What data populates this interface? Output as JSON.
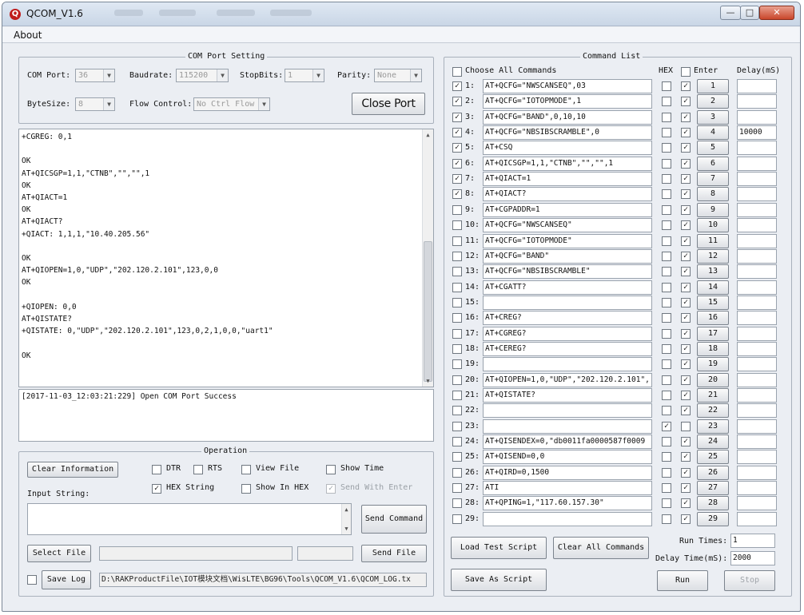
{
  "window": {
    "title": "QCOM_V1.6",
    "app_icon_glyph": "Q",
    "controls": {
      "minimize": "—",
      "maximize": "□",
      "close": "✕"
    }
  },
  "menu": {
    "about": "About"
  },
  "com_port": {
    "group_label": "COM Port Setting",
    "com_port_label": "COM Port:",
    "com_port_value": "36",
    "baudrate_label": "Baudrate:",
    "baudrate_value": "115200",
    "stopbits_label": "StopBits:",
    "stopbits_value": "1",
    "parity_label": "Parity:",
    "parity_value": "None",
    "bytesize_label": "ByteSize:",
    "bytesize_value": "8",
    "flow_label": "Flow Control:",
    "flow_value": "No Ctrl Flow",
    "close_port_label": "Close Port",
    "dropdown_icon": "▼"
  },
  "receive_log": [
    "+CGREG: 0,1",
    "",
    "OK",
    "AT+QICSGP=1,1,\"CTNB\",\"\",\"\",1",
    "OK",
    "AT+QIACT=1",
    "OK",
    "AT+QIACT?",
    "+QIACT: 1,1,1,\"10.40.205.56\"",
    "",
    "OK",
    "AT+QIOPEN=1,0,\"UDP\",\"202.120.2.101\",123,0,0",
    "OK",
    "",
    "+QIOPEN: 0,0",
    "AT+QISTATE?",
    "+QISTATE: 0,\"UDP\",\"202.120.2.101\",123,0,2,1,0,0,\"uart1\"",
    "",
    "OK"
  ],
  "status_log": "[2017-11-03_12:03:21:229] Open COM Port Success",
  "operation": {
    "group_label": "Operation",
    "clear_info_label": "Clear Information",
    "input_string_label": "Input String:",
    "dtr_label": "DTR",
    "dtr_checked": false,
    "rts_label": "RTS",
    "rts_checked": false,
    "view_file_label": "View File",
    "view_file_checked": false,
    "show_time_label": "Show Time",
    "show_time_checked": false,
    "hex_string_label": "HEX String",
    "hex_string_checked": true,
    "show_in_hex_label": "Show In HEX",
    "show_in_hex_checked": false,
    "send_with_enter_label": "Send With Enter",
    "send_with_enter_checked": true,
    "send_command_label": "Send Command",
    "select_file_label": "Select File",
    "send_file_label": "Send File",
    "save_log_label": "Save Log",
    "save_log_checked": false,
    "log_path": "D:\\RAKProductFile\\IOT模块文档\\WisLTE\\BG96\\Tools\\QCOM_V1.6\\QCOM_LOG.tx"
  },
  "command_list": {
    "group_label": "Command List",
    "choose_all_label": "Choose All Commands",
    "hex_header": "HEX",
    "enter_header": "Enter",
    "delay_header": "Delay(mS)",
    "commands": [
      {
        "num": "1:",
        "checked": true,
        "cmd": "AT+QCFG=\"NWSCANSEQ\",03",
        "hex": false,
        "enter": true,
        "btn": "1",
        "delay": ""
      },
      {
        "num": "2:",
        "checked": true,
        "cmd": "AT+QCFG=\"IOTOPMODE\",1",
        "hex": false,
        "enter": true,
        "btn": "2",
        "delay": ""
      },
      {
        "num": "3:",
        "checked": true,
        "cmd": "AT+QCFG=\"BAND\",0,10,10",
        "hex": false,
        "enter": true,
        "btn": "3",
        "delay": ""
      },
      {
        "num": "4:",
        "checked": true,
        "cmd": "AT+QCFG=\"NBSIBSCRAMBLE\",0",
        "hex": false,
        "enter": true,
        "btn": "4",
        "delay": "10000"
      },
      {
        "num": "5:",
        "checked": true,
        "cmd": "AT+CSQ",
        "hex": false,
        "enter": true,
        "btn": "5",
        "delay": ""
      },
      {
        "num": "6:",
        "checked": true,
        "cmd": "AT+QICSGP=1,1,\"CTNB\",\"\",\"\",1",
        "hex": false,
        "enter": true,
        "btn": "6",
        "delay": ""
      },
      {
        "num": "7:",
        "checked": true,
        "cmd": "AT+QIACT=1",
        "hex": false,
        "enter": true,
        "btn": "7",
        "delay": ""
      },
      {
        "num": "8:",
        "checked": true,
        "cmd": "AT+QIACT?",
        "hex": false,
        "enter": true,
        "btn": "8",
        "delay": ""
      },
      {
        "num": "9:",
        "checked": false,
        "cmd": "AT+CGPADDR=1",
        "hex": false,
        "enter": true,
        "btn": "9",
        "delay": ""
      },
      {
        "num": "10:",
        "checked": false,
        "cmd": "AT+QCFG=\"NWSCANSEQ\"",
        "hex": false,
        "enter": true,
        "btn": "10",
        "delay": ""
      },
      {
        "num": "11:",
        "checked": false,
        "cmd": "AT+QCFG=\"IOTOPMODE\"",
        "hex": false,
        "enter": true,
        "btn": "11",
        "delay": ""
      },
      {
        "num": "12:",
        "checked": false,
        "cmd": "AT+QCFG=\"BAND\"",
        "hex": false,
        "enter": true,
        "btn": "12",
        "delay": ""
      },
      {
        "num": "13:",
        "checked": false,
        "cmd": "AT+QCFG=\"NBSIBSCRAMBLE\"",
        "hex": false,
        "enter": true,
        "btn": "13",
        "delay": ""
      },
      {
        "num": "14:",
        "checked": false,
        "cmd": "AT+CGATT?",
        "hex": false,
        "enter": true,
        "btn": "14",
        "delay": ""
      },
      {
        "num": "15:",
        "checked": false,
        "cmd": "",
        "hex": false,
        "enter": true,
        "btn": "15",
        "delay": ""
      },
      {
        "num": "16:",
        "checked": false,
        "cmd": "AT+CREG?",
        "hex": false,
        "enter": true,
        "btn": "16",
        "delay": ""
      },
      {
        "num": "17:",
        "checked": false,
        "cmd": "AT+CGREG?",
        "hex": false,
        "enter": true,
        "btn": "17",
        "delay": ""
      },
      {
        "num": "18:",
        "checked": false,
        "cmd": "AT+CEREG?",
        "hex": false,
        "enter": true,
        "btn": "18",
        "delay": ""
      },
      {
        "num": "19:",
        "checked": false,
        "cmd": "",
        "hex": false,
        "enter": true,
        "btn": "19",
        "delay": ""
      },
      {
        "num": "20:",
        "checked": false,
        "cmd": "AT+QIOPEN=1,0,\"UDP\",\"202.120.2.101\",",
        "hex": false,
        "enter": true,
        "btn": "20",
        "delay": ""
      },
      {
        "num": "21:",
        "checked": false,
        "cmd": "AT+QISTATE?",
        "hex": false,
        "enter": true,
        "btn": "21",
        "delay": ""
      },
      {
        "num": "22:",
        "checked": false,
        "cmd": "",
        "hex": false,
        "enter": true,
        "btn": "22",
        "delay": ""
      },
      {
        "num": "23:",
        "checked": false,
        "cmd": "",
        "hex": true,
        "enter": false,
        "btn": "23",
        "delay": ""
      },
      {
        "num": "24:",
        "checked": false,
        "cmd": "AT+QISENDEX=0,\"db0011fa0000587f0009",
        "hex": false,
        "enter": true,
        "btn": "24",
        "delay": ""
      },
      {
        "num": "25:",
        "checked": false,
        "cmd": "AT+QISEND=0,0",
        "hex": false,
        "enter": true,
        "btn": "25",
        "delay": ""
      },
      {
        "num": "26:",
        "checked": false,
        "cmd": "AT+QIRD=0,1500",
        "hex": false,
        "enter": true,
        "btn": "26",
        "delay": ""
      },
      {
        "num": "27:",
        "checked": false,
        "cmd": "ATI",
        "hex": false,
        "enter": true,
        "btn": "27",
        "delay": ""
      },
      {
        "num": "28:",
        "checked": false,
        "cmd": "AT+QPING=1,\"117.60.157.30\"",
        "hex": false,
        "enter": true,
        "btn": "28",
        "delay": ""
      },
      {
        "num": "29:",
        "checked": false,
        "cmd": "",
        "hex": false,
        "enter": true,
        "btn": "29",
        "delay": ""
      }
    ],
    "load_script_label": "Load Test Script",
    "clear_all_label": "Clear All Commands",
    "save_script_label": "Save As Script",
    "run_times_label": "Run Times:",
    "run_times_value": "1",
    "delay_time_label": "Delay Time(mS):",
    "delay_time_value": "2000",
    "run_label": "Run",
    "stop_label": "Stop"
  },
  "check_glyph": "✓"
}
